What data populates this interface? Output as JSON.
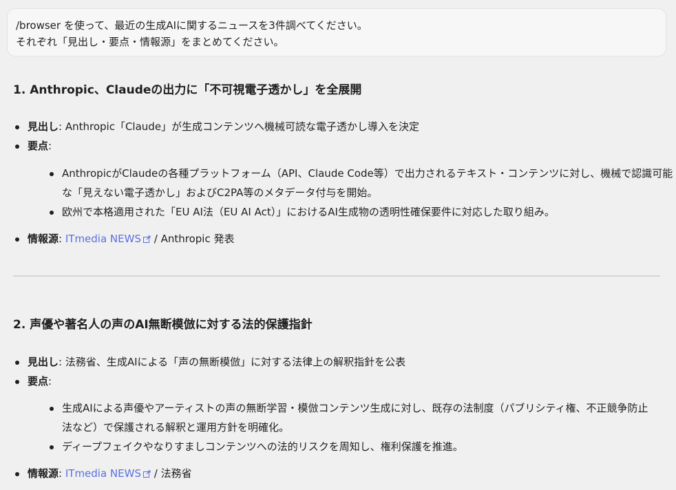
{
  "prompt": {
    "line1": "/browser を使って、最近の生成AIに関するニュースを3件調べてください。",
    "line2": "それぞれ「見出し・要点・情報源」をまとめてください。"
  },
  "labels": {
    "headline": "見出し",
    "points": "要点",
    "source": "情報源",
    "colon": ":"
  },
  "articles": [
    {
      "title": "1. Anthropic、Claudeの出力に「不可視電子透かし」を全展開",
      "headline": " Anthropic「Claude」が生成コンテンツへ機械可読な電子透かし導入を決定",
      "points": [
        {
          "line1": "AnthropicがClaudeの各種プラットフォーム（API、Claude Code等）で出力されるテキスト・コンテンツに対し、機械で認識可能",
          "line2": "な「見えない電子透かし」およびC2PA等のメタデータ付与を開始。"
        },
        {
          "line1": "欧州で本格適用された「EU AI法（EU AI Act）」におけるAI生成物の透明性確保要件に対応した取り組み。"
        }
      ],
      "source_link": "ITmedia NEWS",
      "source_rest": " / Anthropic 発表"
    },
    {
      "title": "2. 声優や著名人の声のAI無断模倣に対する法的保護指針",
      "headline": " 法務省、生成AIによる「声の無断模倣」に対する法律上の解釈指針を公表",
      "points": [
        {
          "line1": "生成AIによる声優やアーティストの声の無断学習・模倣コンテンツ生成に対し、既存の法制度（パブリシティ権、不正競争防止",
          "line2": "法など）で保護される解釈と運用方針を明確化。"
        },
        {
          "line1": "ディープフェイクやなりすましコンテンツへの法的リスクを周知し、権利保護を推進。"
        }
      ],
      "source_link": "ITmedia NEWS",
      "source_rest": " / 法務省"
    }
  ],
  "colors": {
    "background": "#f0f0f0",
    "bubble": "#f7f7f7",
    "link": "#5b6ee1",
    "divider": "#d4d4d4"
  },
  "icons": {
    "external_link": "external-link-icon"
  }
}
